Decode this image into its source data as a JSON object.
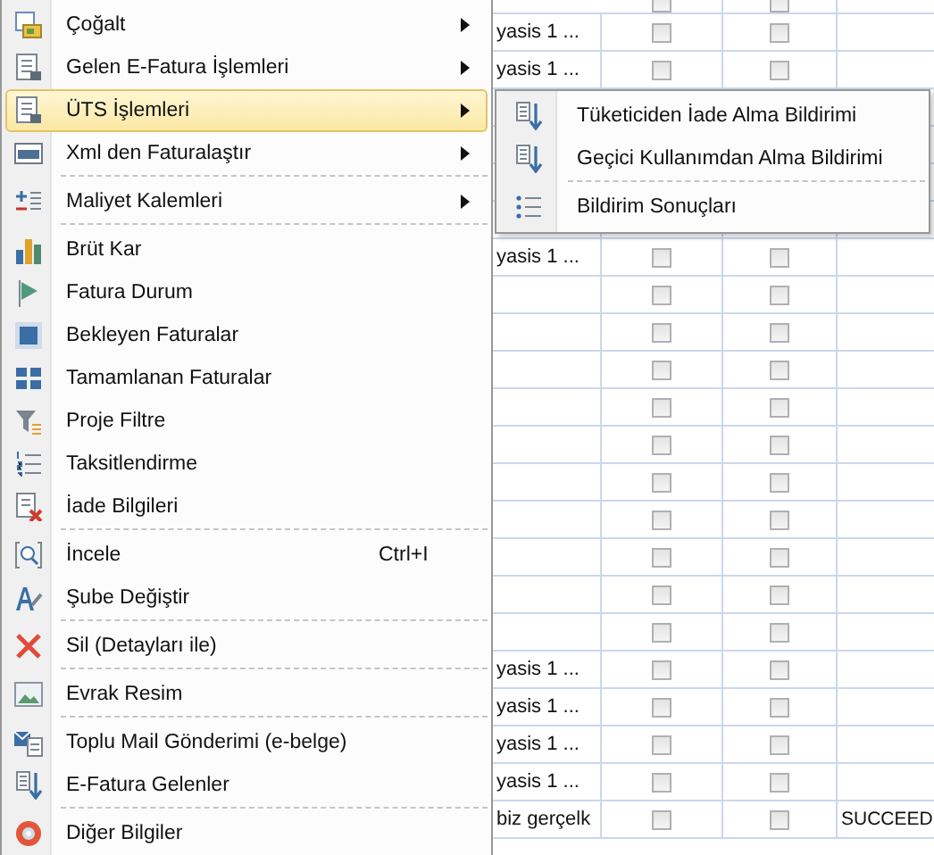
{
  "grid": {
    "rows": [
      {
        "col_1": "",
        "checks": [
          false,
          false
        ],
        "col_4": ""
      },
      {
        "col_1": "yasis 1 ...",
        "checks": [
          false,
          false
        ],
        "col_4": ""
      },
      {
        "col_1": "yasis 1 ...",
        "checks": [
          false,
          false
        ],
        "col_4": ""
      },
      {
        "col_1": "",
        "checks": [],
        "col_4": ""
      },
      {
        "col_1": "",
        "checks": [],
        "col_4": ""
      },
      {
        "col_1": "",
        "checks": [],
        "col_4": ""
      },
      {
        "col_1": "",
        "checks": [],
        "col_4": ""
      },
      {
        "col_1": "yasis 1 ...",
        "checks": [
          false,
          false
        ],
        "col_4": ""
      },
      {
        "col_1": "",
        "checks": [
          false,
          false
        ],
        "col_4": ""
      },
      {
        "col_1": "",
        "checks": [
          false,
          false
        ],
        "col_4": ""
      },
      {
        "col_1": "",
        "checks": [
          false,
          false
        ],
        "col_4": ""
      },
      {
        "col_1": "",
        "checks": [
          false,
          false
        ],
        "col_4": ""
      },
      {
        "col_1": "",
        "checks": [
          false,
          false
        ],
        "col_4": ""
      },
      {
        "col_1": "",
        "checks": [
          false,
          false
        ],
        "col_4": ""
      },
      {
        "col_1": "",
        "checks": [
          false,
          false
        ],
        "col_4": ""
      },
      {
        "col_1": "",
        "checks": [
          false,
          false
        ],
        "col_4": ""
      },
      {
        "col_1": "",
        "checks": [
          false,
          false
        ],
        "col_4": ""
      },
      {
        "col_1": "",
        "checks": [
          false,
          false
        ],
        "col_4": ""
      },
      {
        "col_1": "yasis 1 ...",
        "checks": [
          false,
          false
        ],
        "col_4": ""
      },
      {
        "col_1": "yasis 1 ...",
        "checks": [
          false,
          false
        ],
        "col_4": ""
      },
      {
        "col_1": "yasis 1 ...",
        "checks": [
          false,
          false
        ],
        "col_4": ""
      },
      {
        "col_1": "yasis 1 ...",
        "checks": [
          false,
          false
        ],
        "col_4": ""
      },
      {
        "col_1": "biz gerçelk",
        "checks": [
          false,
          false
        ],
        "col_4": "SUCCEED"
      }
    ]
  },
  "context_menu": {
    "items": [
      {
        "kind": "item",
        "label": "Çoğalt",
        "submenu": true,
        "selected": false
      },
      {
        "kind": "item",
        "label": "Gelen E-Fatura İşlemleri",
        "submenu": true,
        "selected": false
      },
      {
        "kind": "item",
        "label": "ÜTS İşlemleri",
        "submenu": true,
        "selected": true
      },
      {
        "kind": "item",
        "label": "Xml den Faturalaştır",
        "submenu": true,
        "selected": false
      },
      {
        "kind": "separator"
      },
      {
        "kind": "item",
        "label": "Maliyet Kalemleri",
        "submenu": true,
        "selected": false
      },
      {
        "kind": "separator"
      },
      {
        "kind": "item",
        "label": "Brüt Kar",
        "submenu": false,
        "selected": false
      },
      {
        "kind": "item",
        "label": "Fatura Durum",
        "submenu": false,
        "selected": false
      },
      {
        "kind": "item",
        "label": "Bekleyen Faturalar",
        "submenu": false,
        "selected": false
      },
      {
        "kind": "item",
        "label": "Tamamlanan Faturalar",
        "submenu": false,
        "selected": false
      },
      {
        "kind": "item",
        "label": "Proje Filtre",
        "submenu": false,
        "selected": false
      },
      {
        "kind": "item",
        "label": "Taksitlendirme",
        "submenu": false,
        "selected": false
      },
      {
        "kind": "item",
        "label": "İade Bilgileri",
        "submenu": false,
        "selected": false
      },
      {
        "kind": "separator"
      },
      {
        "kind": "item",
        "label": "İncele",
        "shortcut": "Ctrl+I",
        "submenu": false,
        "selected": false
      },
      {
        "kind": "item",
        "label": "Şube Değiştir",
        "submenu": false,
        "selected": false
      },
      {
        "kind": "separator"
      },
      {
        "kind": "item",
        "label": "Sil (Detayları ile)",
        "submenu": false,
        "selected": false
      },
      {
        "kind": "separator"
      },
      {
        "kind": "item",
        "label": "Evrak Resim",
        "submenu": false,
        "selected": false
      },
      {
        "kind": "separator"
      },
      {
        "kind": "item",
        "label": "Toplu Mail Gönderimi (e-belge)",
        "submenu": false,
        "selected": false
      },
      {
        "kind": "item",
        "label": "E-Fatura Gelenler",
        "submenu": false,
        "selected": false
      },
      {
        "kind": "separator"
      },
      {
        "kind": "item",
        "label": "Diğer Bilgiler",
        "submenu": false,
        "selected": false
      }
    ]
  },
  "submenu": {
    "items": [
      {
        "kind": "item",
        "label": "Tüketiciden İade Alma Bildirimi",
        "selected": false
      },
      {
        "kind": "item",
        "label": "Geçici Kullanımdan Alma Bildirimi",
        "selected": false
      },
      {
        "kind": "separator"
      },
      {
        "kind": "item",
        "label": "Bildirim Sonuçları",
        "selected": false
      }
    ]
  }
}
